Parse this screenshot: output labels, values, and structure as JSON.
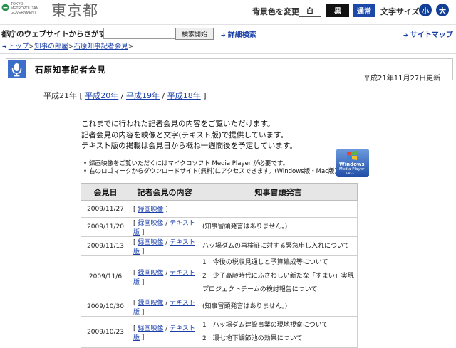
{
  "header": {
    "logo": {
      "text_en": [
        "TOKYO",
        "METROPOLITAN",
        "GOVERNMENT"
      ],
      "text_jp": "東京都"
    },
    "bg_color_label": "背景色を変更",
    "bg_buttons": {
      "white": "白",
      "black": "黒",
      "normal": "通常"
    },
    "font_size_label": "文字サイズ",
    "font_buttons": {
      "small": "小",
      "large": "大"
    }
  },
  "search": {
    "title": "都庁のウェブサイトからさがす",
    "input_value": "",
    "button_label": "検索開始",
    "advanced_label": "詳細検索",
    "sitemap_label": "サイトマップ"
  },
  "breadcrumb": {
    "items": [
      "トップ",
      "知事の部屋",
      "石原知事記者会見"
    ]
  },
  "page": {
    "title": "石原知事記者会見",
    "updated": "平成21年11月27日更新"
  },
  "year_nav": {
    "current": "平成21年",
    "links": [
      "平成20年",
      "平成19年",
      "平成18年"
    ]
  },
  "intro": [
    "これまでに行われた記者会見の内容をご覧いただけます。",
    "記者会見の内容を映像と文字(テキスト版)で提供しています。",
    "テキスト版の掲載は会見日から概ね一週間後を予定しています。"
  ],
  "notes": [
    "録画映像をご覧いただくにはマイクロソフト Media Player が必要です。",
    "右のロゴマークからダウンロードサイト(無料)にアクセスできます。(Windows版・Mac版)"
  ],
  "wmp_logo": {
    "line1": "Windows",
    "line2": "Media Player",
    "line3": "FREE"
  },
  "table": {
    "headers": [
      "会見日",
      "記者会見の内容",
      "知事冒頭発言"
    ],
    "link_video": "録画映像",
    "link_text": "テキスト版",
    "rows": [
      {
        "date": "2009/11/27",
        "topics": []
      },
      {
        "date": "2009/11/20",
        "topics": [
          "(知事冒頭発言はありません。)"
        ]
      },
      {
        "date": "2009/11/13",
        "topics": [
          "ハッ場ダムの再検証に対する緊急申し入れについて"
        ]
      },
      {
        "date": "2009/11/6",
        "topics": [
          "1　今後の税収見通しと予算編成等について",
          "2　少子高齢時代にふさわしい新たな「すまい」実現プロジェクトチームの検討報告について"
        ]
      },
      {
        "date": "2009/10/30",
        "topics": [
          "(知事冒頭発言はありません。)"
        ]
      },
      {
        "date": "2009/10/23",
        "topics": [
          "1　ハッ場ダム建設事業の現地視察について",
          "2　環七地下調節池の効果について"
        ]
      }
    ]
  }
}
